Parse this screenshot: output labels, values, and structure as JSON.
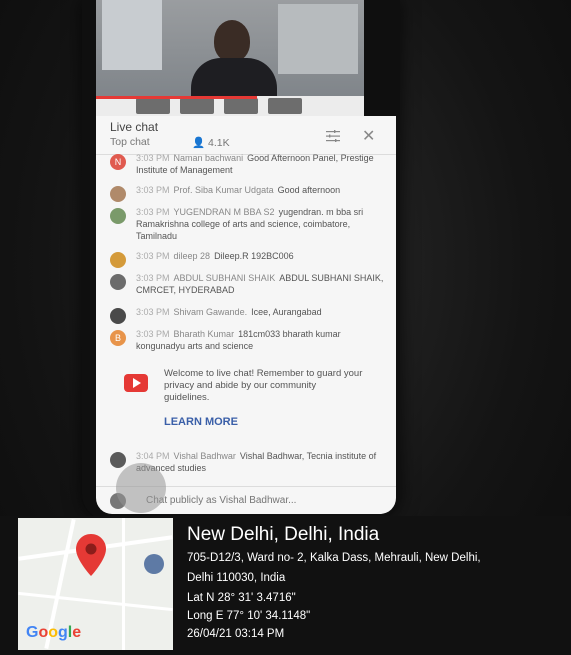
{
  "chat": {
    "title": "Live chat",
    "mode": "Top chat",
    "viewers": "4.1K",
    "icons": {
      "filter": "filter-icon",
      "close": "close-icon",
      "viewers": "person-icon"
    },
    "messages": [
      {
        "avatar": "N",
        "time": "3:03 PM",
        "author": "Naman bachwani",
        "text": "Good Afternoon Panel, Prestige Institute of Management"
      },
      {
        "avatar": "",
        "time": "3:03 PM",
        "author": "Prof. Siba Kumar Udgata",
        "text": "Good afternoon"
      },
      {
        "avatar": "",
        "time": "3:03 PM",
        "author": "YUGENDRAN M BBA S2",
        "text": "yugendran. m bba sri Ramakrishna college of arts and science, coimbatore, Tamilnadu"
      },
      {
        "avatar": "",
        "time": "3:03 PM",
        "author": "dileep 28",
        "text": "Dileep.R 192BC006"
      },
      {
        "avatar": "",
        "time": "3:03 PM",
        "author": "ABDUL SUBHANI SHAIK",
        "text": "ABDUL SUBHANI SHAIK, CMRCET, HYDERABAD"
      },
      {
        "avatar": "",
        "time": "3:03 PM",
        "author": "Shivam Gawande.",
        "text": "Icee, Aurangabad"
      },
      {
        "avatar": "B",
        "time": "3:03 PM",
        "author": "Bharath Kumar",
        "text": "181cm033 bharath kumar kongunadyu arts and science"
      }
    ],
    "welcome": {
      "text": "Welcome to live chat! Remember to guard your privacy and abide by our community guidelines.",
      "link": "LEARN MORE"
    },
    "last_message": {
      "time": "3:04 PM",
      "author": "Vishal Badhwar",
      "text": "Vishal Badhwar, Tecnia institute of advanced studies"
    },
    "composer_placeholder": "Chat publicly as Vishal Badhwar..."
  },
  "location": {
    "title": "New Delhi, Delhi, India",
    "address_line1": "705-D12/3, Ward no- 2, Kalka Dass, Mehrauli, New Delhi,",
    "address_line2": "Delhi 110030, India",
    "lat": "Lat N 28° 31' 3.4716\"",
    "long": "Long E 77° 10' 34.1148\"",
    "datetime": "26/04/21 03:14 PM",
    "map_logo": "Google"
  },
  "colors": {
    "youtube_red": "#e53935",
    "link_blue": "#3a5fa8",
    "map_pin": "#e53935"
  }
}
